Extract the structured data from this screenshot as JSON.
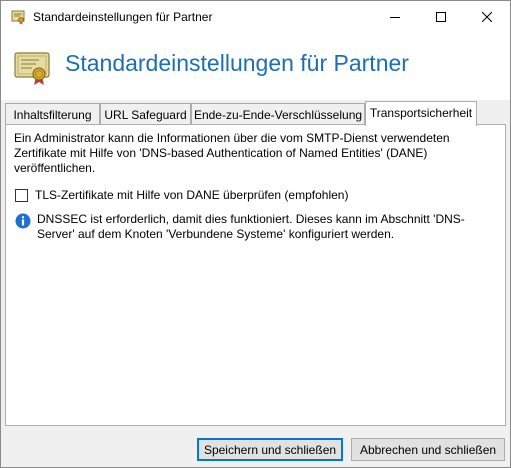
{
  "window": {
    "title": "Standardeinstellungen für Partner"
  },
  "header": {
    "title": "Standardeinstellungen für Partner"
  },
  "tabs": [
    {
      "label": "Inhaltsfilterung",
      "active": false
    },
    {
      "label": "URL Safeguard",
      "active": false
    },
    {
      "label": "Ende-zu-Ende-Verschlüsselung",
      "active": false
    },
    {
      "label": "Transportsicherheit",
      "active": true
    }
  ],
  "transport": {
    "description": "Ein Administrator kann die Informationen über die vom SMTP-Dienst verwendeten Zertifikate mit Hilfe von 'DNS-based Authentication of Named Entities' (DANE) veröffentlichen.",
    "dane_checkbox_label": "TLS-Zertifikate mit Hilfe von DANE überprüfen (empfohlen)",
    "dane_checked": false,
    "info_text": "DNSSEC ist erforderlich, damit dies funktioniert. Dieses kann im Abschnitt 'DNS-Server' auf dem Knoten 'Verbundene Systeme' konfiguriert werden."
  },
  "footer": {
    "save_label": "Speichern und schließen",
    "cancel_label": "Abbrechen und schließen"
  },
  "colors": {
    "header_title": "#1b6fb5",
    "info_icon": "#1e6fd0",
    "default_button_border": "#0078d7"
  },
  "icons": {
    "title": "certificate-icon",
    "header": "certificate-icon",
    "info": "info-icon"
  }
}
